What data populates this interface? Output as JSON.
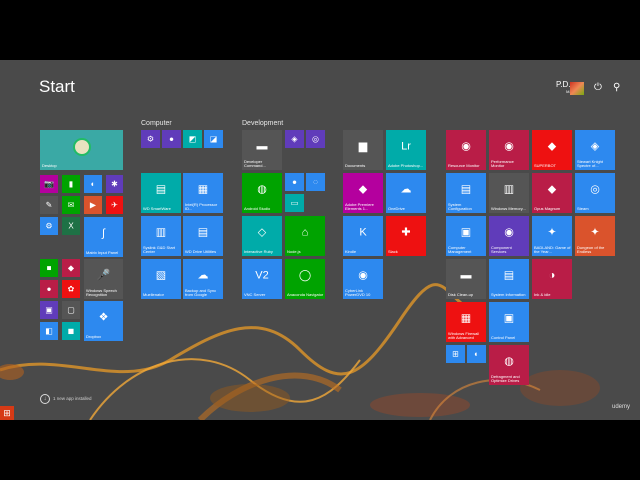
{
  "header": {
    "title": "Start",
    "user_line1": "P.D.",
    "user_line2": "M.",
    "power_icon": "power-icon",
    "search_icon": "search-icon"
  },
  "groups": {
    "computer": "Computer",
    "development": "Development"
  },
  "footer": {
    "new_apps_text": "1 new app installed"
  },
  "watermark": "udemy",
  "tiles": [
    {
      "key": "desktop",
      "label": "Desktop",
      "icon": "desktop-icon",
      "glyph": "",
      "color": "#3aa9a5"
    },
    {
      "key": "camera",
      "label": "",
      "icon": "camera-icon",
      "glyph": "📷",
      "color": "#b4009e"
    },
    {
      "key": "t2",
      "label": "",
      "icon": "app-icon",
      "glyph": "▮",
      "color": "#00a300"
    },
    {
      "key": "t3",
      "label": "",
      "icon": "app-icon",
      "glyph": "◐",
      "color": "#2d89ef"
    },
    {
      "key": "t4",
      "label": "",
      "icon": "app-icon",
      "glyph": "✱",
      "color": "#603cba"
    },
    {
      "key": "t5",
      "label": "",
      "icon": "app-icon",
      "glyph": "✎",
      "color": "#555"
    },
    {
      "key": "t6",
      "label": "",
      "icon": "app-icon",
      "glyph": "✉",
      "color": "#00a300"
    },
    {
      "key": "t7",
      "label": "",
      "icon": "app-icon",
      "glyph": "▶",
      "color": "#da532c"
    },
    {
      "key": "t8",
      "label": "",
      "icon": "app-icon",
      "glyph": "✈",
      "color": "#ee1111"
    },
    {
      "key": "t9",
      "label": "",
      "icon": "app-icon",
      "glyph": "⚙",
      "color": "#2d89ef"
    },
    {
      "key": "t10",
      "label": "",
      "icon": "app-icon",
      "glyph": "◉",
      "color": "#00aba9"
    },
    {
      "key": "excel",
      "label": "",
      "icon": "excel-icon",
      "glyph": "X",
      "color": "#1e7145"
    },
    {
      "key": "matrix",
      "label": "Matrix Input Panel",
      "icon": "math-icon",
      "glyph": "∫",
      "color": "#2d89ef"
    },
    {
      "key": "t13",
      "label": "",
      "icon": "app-icon",
      "glyph": "■",
      "color": "#00a300"
    },
    {
      "key": "t14",
      "label": "",
      "icon": "app-icon",
      "glyph": "◆",
      "color": "#b91d47"
    },
    {
      "key": "speech",
      "label": "Windows Speech Recognition",
      "icon": "microphone-icon",
      "glyph": "🎤",
      "color": "#555"
    },
    {
      "key": "t16",
      "label": "",
      "icon": "app-icon",
      "glyph": "●",
      "color": "#b91d47"
    },
    {
      "key": "t17",
      "label": "",
      "icon": "app-icon",
      "glyph": "✿",
      "color": "#ee1111"
    },
    {
      "key": "t18",
      "label": "",
      "icon": "app-icon",
      "glyph": "▣",
      "color": "#603cba"
    },
    {
      "key": "t19",
      "label": "",
      "icon": "app-icon",
      "glyph": "▢",
      "color": "#555"
    },
    {
      "key": "t20",
      "label": "",
      "icon": "app-icon",
      "glyph": "◧",
      "color": "#2d89ef"
    },
    {
      "key": "t21",
      "label": "",
      "icon": "app-icon",
      "glyph": "◼",
      "color": "#00aba9"
    },
    {
      "key": "dropbox",
      "label": "Dropbox",
      "icon": "dropbox-icon",
      "glyph": "❖",
      "color": "#2d89ef"
    },
    {
      "key": "c1",
      "label": "",
      "icon": "gear-icon",
      "glyph": "⚙",
      "color": "#603cba"
    },
    {
      "key": "c2",
      "label": "",
      "icon": "app-icon",
      "glyph": "●",
      "color": "#603cba"
    },
    {
      "key": "c3",
      "label": "",
      "icon": "app-icon",
      "glyph": "◩",
      "color": "#00aba9"
    },
    {
      "key": "c4",
      "label": "",
      "icon": "app-icon",
      "glyph": "◪",
      "color": "#2d89ef"
    },
    {
      "key": "smartwares",
      "label": "WD SmartWare",
      "icon": "drive-icon",
      "glyph": "▤",
      "color": "#00aba9"
    },
    {
      "key": "intel",
      "label": "Intel(R) Processor ID...",
      "icon": "processor-icon",
      "glyph": "▦",
      "color": "#2d89ef"
    },
    {
      "key": "syslink",
      "label": "Syslink G&D Start Center",
      "icon": "app-icon",
      "glyph": "▥",
      "color": "#2d89ef"
    },
    {
      "key": "wddrive",
      "label": "WD Drive Utilities",
      "icon": "drive-icon",
      "glyph": "▤",
      "color": "#2d89ef"
    },
    {
      "key": "muellenator",
      "label": "Muellenator",
      "icon": "app-icon",
      "glyph": "▧",
      "color": "#2d89ef"
    },
    {
      "key": "backup",
      "label": "Backup and Sync from Google",
      "icon": "cloud-icon",
      "glyph": "☁",
      "color": "#2d89ef"
    },
    {
      "key": "devcmd",
      "label": "Developer Command...",
      "icon": "terminal-icon",
      "glyph": "▬",
      "color": "#555"
    },
    {
      "key": "d2",
      "label": "",
      "icon": "app-icon",
      "glyph": "◈",
      "color": "#603cba"
    },
    {
      "key": "d3",
      "label": "",
      "icon": "app-icon",
      "glyph": "◎",
      "color": "#603cba"
    },
    {
      "key": "android",
      "label": "Android Studio",
      "icon": "android-icon",
      "glyph": "◍",
      "color": "#00a300"
    },
    {
      "key": "d5",
      "label": "",
      "icon": "app-icon",
      "glyph": "●",
      "color": "#2d89ef"
    },
    {
      "key": "d6",
      "label": "",
      "icon": "app-icon",
      "glyph": "◌",
      "color": "#2d89ef"
    },
    {
      "key": "d7",
      "label": "",
      "icon": "app-icon",
      "glyph": "▭",
      "color": "#00aba9"
    },
    {
      "key": "ruby",
      "label": "Interactive Ruby",
      "icon": "ruby-icon",
      "glyph": "◇",
      "color": "#00aba9"
    },
    {
      "key": "node",
      "label": "Node.js",
      "icon": "home-icon",
      "glyph": "⌂",
      "color": "#00a300"
    },
    {
      "key": "vnc",
      "label": "VNC Server",
      "icon": "vnc-icon",
      "glyph": "V2",
      "color": "#2d89ef"
    },
    {
      "key": "anaconda",
      "label": "Anaconda Navigator",
      "icon": "anaconda-icon",
      "glyph": "◯",
      "color": "#00a300"
    },
    {
      "key": "docs",
      "label": "Documents",
      "icon": "folder-icon",
      "glyph": "▆",
      "color": "#555"
    },
    {
      "key": "lightroom",
      "label": "Adobe Photoshop...",
      "icon": "lightroom-icon",
      "glyph": "Lr",
      "color": "#00aba9"
    },
    {
      "key": "premiere",
      "label": "Adobe Premiere Elements 1...",
      "icon": "premiere-icon",
      "glyph": "◆",
      "color": "#b4009e"
    },
    {
      "key": "onedrive",
      "label": "OneDrive",
      "icon": "onedrive-icon",
      "glyph": "☁",
      "color": "#2d89ef"
    },
    {
      "key": "kindle",
      "label": "Kindle",
      "icon": "kindle-icon",
      "glyph": "K",
      "color": "#2d89ef"
    },
    {
      "key": "slack",
      "label": "Slack",
      "icon": "slack-icon",
      "glyph": "✚",
      "color": "#ee1111"
    },
    {
      "key": "cyberlink",
      "label": "CyberLink PowerDVD 10",
      "icon": "disc-icon",
      "glyph": "◉",
      "color": "#2d89ef"
    },
    {
      "key": "resmon",
      "label": "Resource Monitor",
      "icon": "monitor-icon",
      "glyph": "◉",
      "color": "#b91d47"
    },
    {
      "key": "perfmon",
      "label": "Performance Monitor",
      "icon": "monitor-icon",
      "glyph": "◉",
      "color": "#b91d47"
    },
    {
      "key": "superbot",
      "label": "SUPERBOT",
      "icon": "robot-icon",
      "glyph": "◆",
      "color": "#ee1111"
    },
    {
      "key": "stewart",
      "label": "Stewart Knight Spectre of...",
      "icon": "game-icon",
      "glyph": "◈",
      "color": "#2d89ef"
    },
    {
      "key": "sysconfig",
      "label": "System Configuration",
      "icon": "config-icon",
      "glyph": "▤",
      "color": "#2d89ef"
    },
    {
      "key": "winmem",
      "label": "Windows Memory...",
      "icon": "memory-icon",
      "glyph": "▥",
      "color": "#555"
    },
    {
      "key": "opus",
      "label": "Opus Magnum",
      "icon": "game-icon",
      "glyph": "◆",
      "color": "#b91d47"
    },
    {
      "key": "steam",
      "label": "Steam",
      "icon": "steam-icon",
      "glyph": "◎",
      "color": "#2d89ef"
    },
    {
      "key": "compmgmt",
      "label": "Computer Management",
      "icon": "computer-icon",
      "glyph": "▣",
      "color": "#2d89ef"
    },
    {
      "key": "components",
      "label": "Component Services",
      "icon": "components-icon",
      "glyph": "◉",
      "color": "#603cba"
    },
    {
      "key": "badland",
      "label": "BADLAND: Game of the Year...",
      "icon": "game-icon",
      "glyph": "✦",
      "color": "#2d89ef"
    },
    {
      "key": "dungeon",
      "label": "Dungeon of the Endless",
      "icon": "game-icon",
      "glyph": "✦",
      "color": "#da532c"
    },
    {
      "key": "diskclean",
      "label": "Disk Clean-up",
      "icon": "disk-icon",
      "glyph": "▬",
      "color": "#555"
    },
    {
      "key": "sysinfo",
      "label": "System Information",
      "icon": "info-icon",
      "glyph": "▤",
      "color": "#2d89ef"
    },
    {
      "key": "ink",
      "label": "Ink & idle",
      "icon": "ink-icon",
      "glyph": "◑",
      "color": "#b91d47"
    },
    {
      "key": "firewall",
      "label": "Windows Firewall with Advanced",
      "icon": "firewall-icon",
      "glyph": "▦",
      "color": "#ee1111"
    },
    {
      "key": "controlpanel",
      "label": "Control Panel",
      "icon": "control-panel-icon",
      "glyph": "▣",
      "color": "#2d89ef"
    },
    {
      "key": "s1",
      "label": "",
      "icon": "app-icon",
      "glyph": "⊞",
      "color": "#2d89ef"
    },
    {
      "key": "s2",
      "label": "",
      "icon": "app-icon",
      "glyph": "◐",
      "color": "#2d89ef"
    },
    {
      "key": "defrag",
      "label": "Defragment and Optimize Drives",
      "icon": "defrag-icon",
      "glyph": "◍",
      "color": "#b91d47"
    }
  ]
}
